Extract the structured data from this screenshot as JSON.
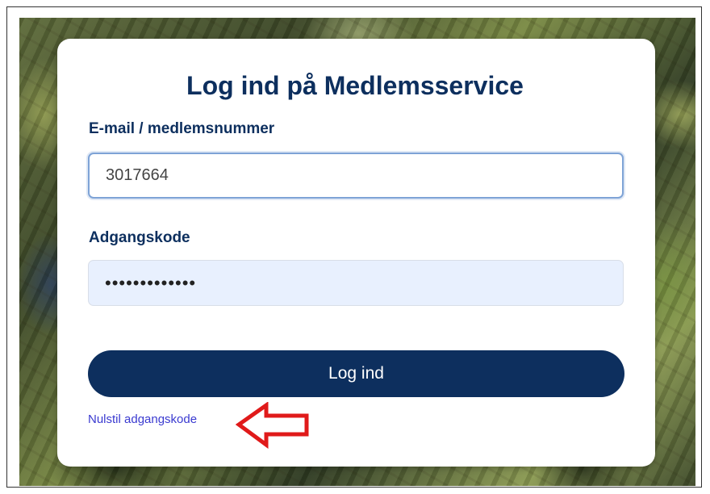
{
  "login": {
    "title": "Log ind på Medlemsservice",
    "email_label": "E-mail / medlemsnummer",
    "email_value": "3017664",
    "password_label": "Adgangskode",
    "password_value": "•••••••••••••",
    "submit_label": "Log ind",
    "reset_link": "Nulstil adgangskode"
  },
  "colors": {
    "primary": "#0d2f5e",
    "link": "#3a3ad0",
    "annotation_arrow": "#e01a1a",
    "autofill_bg": "#e8f0fe"
  },
  "icons": {
    "annotation": "red-arrow-left-icon"
  }
}
